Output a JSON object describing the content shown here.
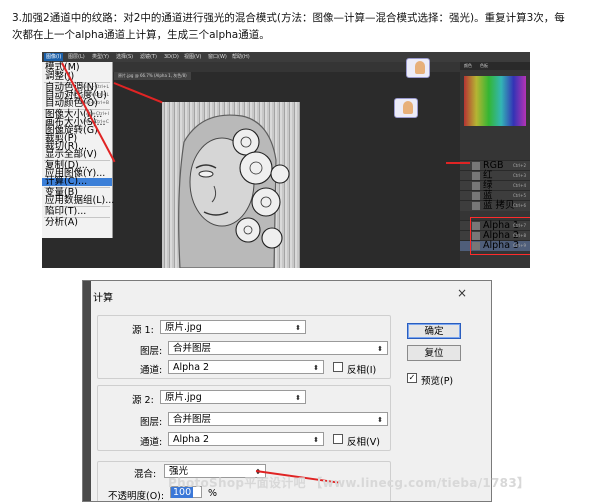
{
  "instruction": "3.加强2通道中的纹路：对2中的通道进行强光的混合模式(方法：图像—计算—混合模式选择：强光)。重复计算3次，每次都在上一个alpha通道上计算，生成三个alpha通道。",
  "photoshop": {
    "menubar": [
      "图像(I)",
      "图层(L)",
      "类型(Y)",
      "选择(S)",
      "滤镜(T)",
      "3D(D)",
      "视图(V)",
      "窗口(W)",
      "帮助(H)"
    ],
    "doc_tab": "原片.jpg @ 66.7% (Alpha 1, 灰色/8)",
    "image_menu": [
      {
        "label": "模式(M)",
        "shortcut": ""
      },
      {
        "label": "调整(J)",
        "shortcut": ""
      },
      {
        "label": "自动色调(N)",
        "shortcut": "Shift+Ctrl+L"
      },
      {
        "label": "自动对比度(U)",
        "shortcut": "Alt+Shift+Ctrl+L"
      },
      {
        "label": "自动颜色(O)",
        "shortcut": "Shift+Ctrl+B"
      },
      {
        "label": "图像大小(I)...",
        "shortcut": "Alt+Ctrl+I"
      },
      {
        "label": "画布大小(S)...",
        "shortcut": "Alt+Ctrl+C"
      },
      {
        "label": "图像旋转(G)",
        "shortcut": ""
      },
      {
        "label": "裁剪(P)",
        "shortcut": ""
      },
      {
        "label": "裁切(R)...",
        "shortcut": ""
      },
      {
        "label": "显示全部(V)",
        "shortcut": ""
      },
      {
        "label": "复制(D)...",
        "shortcut": ""
      },
      {
        "label": "应用图像(Y)...",
        "shortcut": ""
      },
      {
        "label": "计算(C)...",
        "shortcut": ""
      },
      {
        "label": "变量(B)",
        "shortcut": ""
      },
      {
        "label": "应用数据组(L)...",
        "shortcut": ""
      },
      {
        "label": "陷印(T)...",
        "shortcut": ""
      },
      {
        "label": "分析(A)",
        "shortcut": ""
      }
    ],
    "panel_tabs": [
      "颜色",
      "色板"
    ],
    "channels": [
      {
        "label": "RGB",
        "shortcut": "Ctrl+2"
      },
      {
        "label": "红",
        "shortcut": "Ctrl+3"
      },
      {
        "label": "绿",
        "shortcut": "Ctrl+4"
      },
      {
        "label": "蓝",
        "shortcut": "Ctrl+5"
      },
      {
        "label": "蓝 拷贝",
        "shortcut": "Ctrl+6"
      },
      {
        "label": "Alpha 1",
        "shortcut": "Ctrl+7"
      },
      {
        "label": "Alpha 2",
        "shortcut": "Ctrl+8"
      },
      {
        "label": "Alpha 3",
        "shortcut": "Ctrl+9"
      }
    ]
  },
  "dialog": {
    "title": "计算",
    "close_glyph": "×",
    "source1": {
      "label": "源 1:",
      "value": "原片.jpg",
      "layer_label": "图层:",
      "layer_value": "合并图层",
      "channel_label": "通道:",
      "channel_value": "Alpha 2",
      "invert_label": "反相(I)",
      "invert_checked": false
    },
    "source2": {
      "label": "源 2:",
      "value": "原片.jpg",
      "layer_label": "图层:",
      "layer_value": "合并图层",
      "channel_label": "通道:",
      "channel_value": "Alpha 2",
      "invert_label": "反相(V)",
      "invert_checked": false
    },
    "blending": {
      "label": "混合:",
      "value": "强光",
      "opacity_label": "不透明度(O):",
      "opacity_value": "100",
      "opacity_unit": "%"
    },
    "ok_label": "确定",
    "reset_label": "复位",
    "preview_label": "预览(P)",
    "preview_checked": true,
    "check_glyph": "✓"
  },
  "watermark": "PhotoShop平面设计吧 【www.linecg.com/tieba/1783】",
  "colors": {
    "arrow": "#e02424",
    "highlight": "#3b7fd8"
  }
}
